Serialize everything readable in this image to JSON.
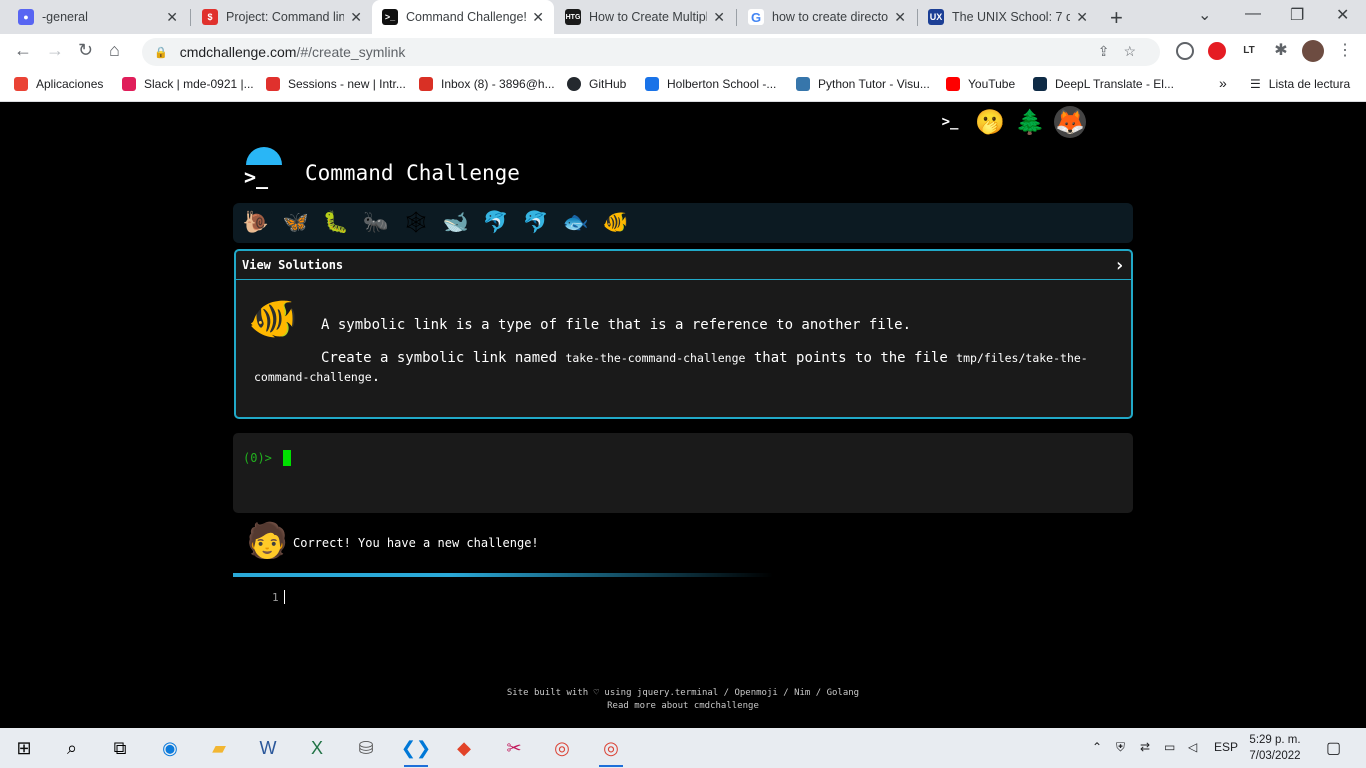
{
  "browser": {
    "tabs": [
      {
        "title": "-general",
        "color": "#5865f2",
        "glyph": "●"
      },
      {
        "title": "Project: Command lin",
        "color": "#e0312d",
        "glyph": "$"
      },
      {
        "title": "Command Challenge!",
        "color": "#111111",
        "glyph": ">_"
      },
      {
        "title": "How to Create Multipl",
        "color": "#1a1a1a",
        "glyph": "HTG"
      },
      {
        "title": "how to create director",
        "color": "#4285f4",
        "glyph": "G"
      },
      {
        "title": "The UNIX School: 7 dif",
        "color": "#1c3f95",
        "glyph": "UX"
      }
    ],
    "url_domain": "cmdchallenge.com",
    "url_path": "/#/create_symlink",
    "bookmarks": [
      {
        "label": "Aplicaciones",
        "color": "#ea4335"
      },
      {
        "label": "Slack | mde-0921 |...",
        "color": "#e01e5a"
      },
      {
        "label": "Sessions - new | Intr...",
        "color": "#e0312d"
      },
      {
        "label": "Inbox (8) - 3896@h...",
        "color": "#d93025"
      },
      {
        "label": "GitHub",
        "color": "#24292e"
      },
      {
        "label": "Holberton School -...",
        "color": "#1a73e8"
      },
      {
        "label": "Python Tutor - Visu...",
        "color": "#3776ab"
      },
      {
        "label": "YouTube",
        "color": "#ff0000"
      },
      {
        "label": "DeepL Translate - El...",
        "color": "#0f2b46"
      }
    ],
    "bookmarks_more": "»",
    "reading_list": "Lista de lectura"
  },
  "page": {
    "title": "Command Challenge",
    "top_icons": [
      "terminal-icon",
      "face-icon",
      "tree-icon",
      "gitlab-icon",
      "mail-icon"
    ],
    "level_icons": [
      "🐌",
      "🦋",
      "🐛",
      "🐜",
      "🕸",
      "🐋",
      "🐬",
      "🐬",
      "🐟",
      "🐠"
    ],
    "view_solutions": "View Solutions",
    "view_solutions_arrow": "›",
    "description_1": "A symbolic link is a type of file that is a reference to another file.",
    "description_2_prefix": "Create a symbolic link named ",
    "description_2_code1": "take-the-command-challenge",
    "description_2_mid": " that points to the file ",
    "description_2_code2": "tmp/files/take-the-command-challenge",
    "description_2_suffix": ".",
    "prompt": "(0)>",
    "feedback": "Correct! You have a new challenge!",
    "line_number": "1",
    "footer_line1": "Site built with ♡ using jquery.terminal / Openmoji / Nim / Golang",
    "footer_line2": "Read more about cmdchallenge"
  },
  "taskbar": {
    "language": "ESP",
    "time": "5:29 p. m.",
    "date": "7/03/2022"
  }
}
